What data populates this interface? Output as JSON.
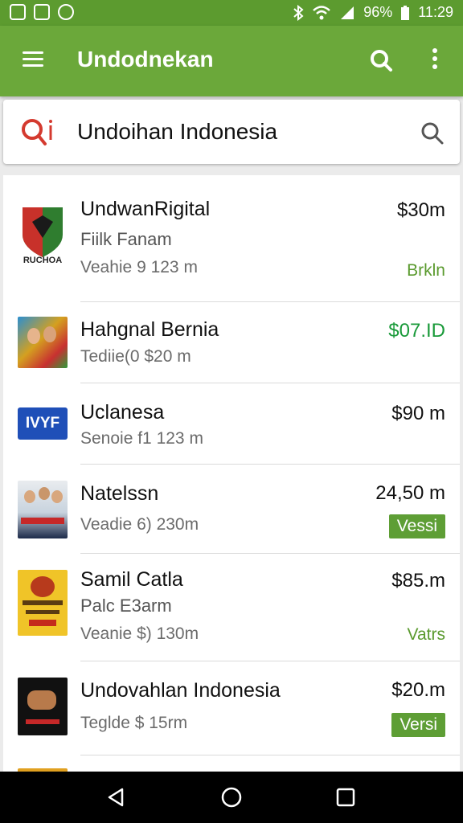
{
  "status_bar": {
    "battery": "96%",
    "time": "11:29"
  },
  "appbar": {
    "title": "Undodnekan"
  },
  "search": {
    "query": "Undoihan Indonesia"
  },
  "items": [
    {
      "name": "UndwanRigital",
      "sub": "Fiilk Fanam",
      "meta": "Veahie 9 123 m",
      "price": "$30m",
      "tag": "Brkln"
    },
    {
      "name": "Hahgnal Bernia",
      "meta": "Tediie(0 $20 m",
      "price": "$07.ID"
    },
    {
      "name": "Uclanesa",
      "meta": "Senoie f1 123 m",
      "price": "$90 m"
    },
    {
      "name": "Natelssn",
      "meta": "Veadie 6) 230m",
      "price": "24,50 m",
      "badge": "Vessi"
    },
    {
      "name": "Samil Catla",
      "sub": "Palc E3arm",
      "meta": "Veanie $) 130m",
      "price": "$85.m",
      "tag": "Vatrs"
    },
    {
      "name": "Undovahlan Indonesia",
      "meta": "Teglde $ 15rm",
      "price": "$20.m",
      "badge": "Versi"
    }
  ],
  "thumb_labels": {
    "t0": "RUCHOA",
    "t2": "IVYF"
  },
  "colors": {
    "status_bar": "#5c9b2f",
    "app_bar": "#6ba83a",
    "price_green": "#1a9a3a",
    "badge_green": "#5e9e35"
  }
}
